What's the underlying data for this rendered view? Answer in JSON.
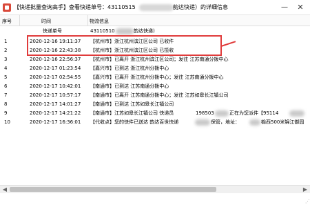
{
  "window": {
    "title_prefix": "【快递批量查询高手】查看快递单号：43110515",
    "title_suffix": "韵达快递）的详细信息",
    "minimize_label": "—",
    "close_label": "✕"
  },
  "table": {
    "headers": {
      "seq": "序号",
      "time": "时间",
      "info": "物流信息"
    },
    "subheader": {
      "time": "快递单号",
      "info_prefix": "43110510",
      "info_suffix": "韵达快递)"
    },
    "rows": [
      {
        "num": "1",
        "time": "2020-12-16 19:11:37",
        "info": "【杭州市】浙江杭州滨江区公司 已收件"
      },
      {
        "num": "2",
        "time": "2020-12-16 22:43:38",
        "info": "【杭州市】浙江杭州滨江区公司 已揽收"
      },
      {
        "num": "3",
        "time": "2020-12-16 22:56:37",
        "info": "【杭州市】已离开 浙江杭州滨江区公司；发往 江苏南通分拨中心"
      },
      {
        "num": "4",
        "time": "2020-12-17 01:23:54",
        "info": "【嘉兴市】已到达 浙江杭州分拨中心"
      },
      {
        "num": "5",
        "time": "2020-12-17 02:54:55",
        "info": "【嘉兴市】已离开 浙江杭州分拨中心；发往 江苏南通分拨中心"
      },
      {
        "num": "6",
        "time": "2020-12-17 10:42:01",
        "info": "【南通市】已到达 江苏南通分拨中心"
      },
      {
        "num": "7",
        "time": "2020-12-17 10:57:17",
        "info": "【南通市】已离开 江苏南通分拨中心；发往 江苏如皋长江镇公司"
      },
      {
        "num": "8",
        "time": "2020-12-17 14:01:27",
        "info": "【南通市】已到达 江苏如皋长江镇公司"
      },
      {
        "num": "9",
        "time": "2020-12-17 14:21:22",
        "info": "【南通市】江苏如皋长江镇公司 快递员",
        "info_mid": "198503",
        "info_end": "正在为您派件【95114"
      },
      {
        "num": "10",
        "time": "2020-12-17 16:36:01",
        "info": "【代收点】您的快件已送达 韵达百世快递",
        "info_mid": "保管，地址：",
        "info_end": "榆西500米锦江御园"
      }
    ]
  },
  "scrollbar": {
    "left_arrow": "◀",
    "right_arrow": "▶"
  },
  "grip": "⋰",
  "colors": {
    "highlight": "#e03b3b",
    "blur": "#c9c9c9"
  }
}
